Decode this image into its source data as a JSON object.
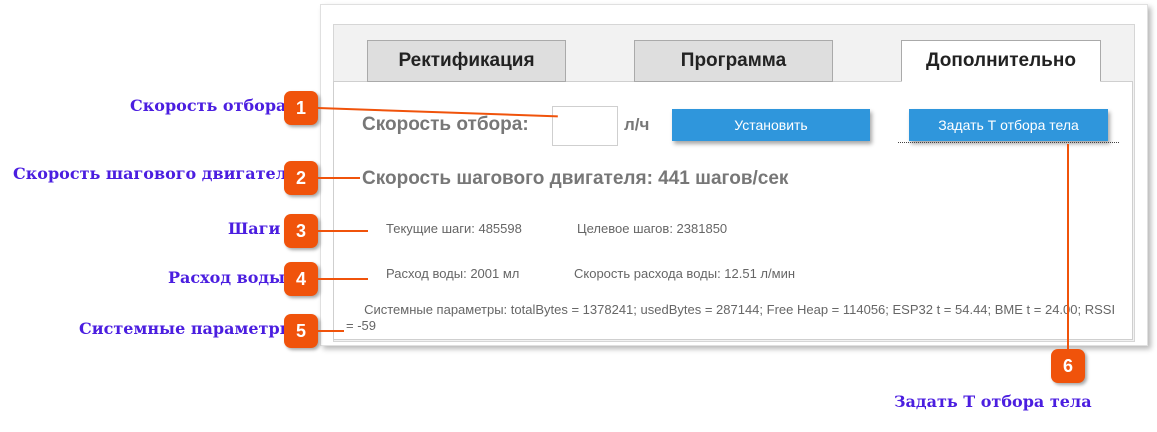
{
  "tabs": [
    {
      "label": "Ректификация",
      "active": false
    },
    {
      "label": "Программа",
      "active": false
    },
    {
      "label": "Дополнительно",
      "active": true
    }
  ],
  "speed": {
    "label": "Скорость отбора:",
    "input_value": "",
    "unit": "л/ч"
  },
  "buttons": {
    "set": "Установить",
    "body_temp": "Задать Т отбора тела"
  },
  "motor": {
    "text": "Скорость шагового двигателя: 441 шагов/сек"
  },
  "steps": {
    "current": "Текущие шаги: 485598",
    "target": "Целевое шагов: 2381850"
  },
  "water": {
    "consumption": "Расход воды: 2001 мл",
    "rate": "Скорость расхода воды: 12.51 л/мин"
  },
  "system": {
    "text": "Системные параметры: totalBytes = 1378241; usedBytes = 287144; Free Heap = 114056; ESP32 t = 54.44; BME t = 24.00; RSSI = -59"
  },
  "callouts": [
    {
      "num": "1",
      "label": "Скорость отбора"
    },
    {
      "num": "2",
      "label": "Скорость шагового двигателя"
    },
    {
      "num": "3",
      "label": "Шаги"
    },
    {
      "num": "4",
      "label": "Расход воды"
    },
    {
      "num": "5",
      "label": "Системные параметры"
    },
    {
      "num": "6",
      "label": "Задать Т отбора тела"
    }
  ],
  "colors": {
    "accent_button": "#2f96dc",
    "callout_badge": "#f0530b",
    "callout_text": "#4b1ee0"
  }
}
